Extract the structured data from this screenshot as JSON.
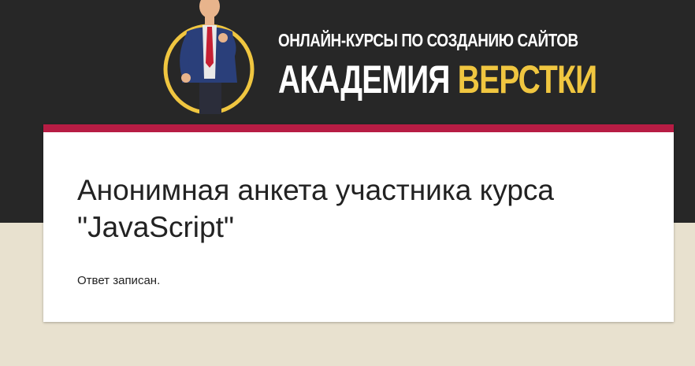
{
  "header": {
    "tagline": "ОНЛАЙН-КУРСЫ ПО СОЗДАНИЮ САЙТОВ",
    "brand_main": "АКАДЕМИЯ ",
    "brand_accent": "ВЕРСТКИ",
    "colors": {
      "banner": "#272727",
      "accent_yellow": "#f0c640"
    }
  },
  "form": {
    "title": "Анонимная анкета участника курса \"JavaScript\"",
    "confirmation": "Ответ записан.",
    "accent_color": "#b71c44"
  }
}
